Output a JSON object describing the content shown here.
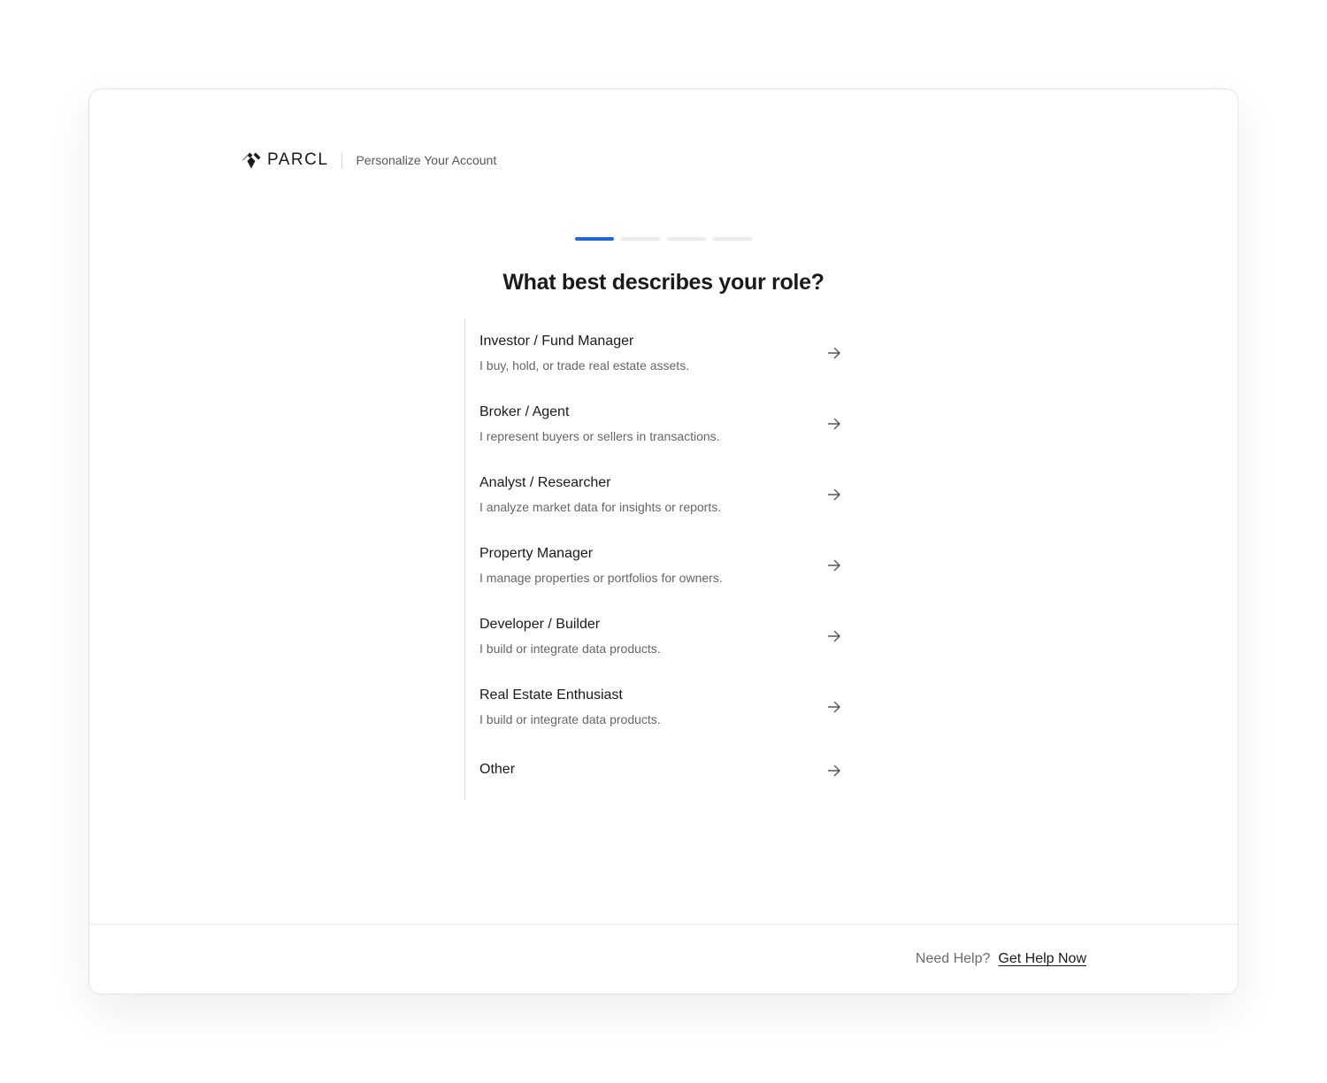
{
  "brand": {
    "logo_text": "PARCL",
    "subtitle": "Personalize Your Account"
  },
  "stepper": {
    "total_steps": 4,
    "current_step": 1,
    "accent_color": "#2563d9"
  },
  "question": "What best describes your role?",
  "options": [
    {
      "title": "Investor / Fund Manager",
      "description": "I buy, hold, or trade real estate assets."
    },
    {
      "title": "Broker / Agent",
      "description": "I represent buyers or sellers in transactions."
    },
    {
      "title": "Analyst / Researcher",
      "description": "I analyze market data for insights or reports."
    },
    {
      "title": "Property Manager",
      "description": "I manage properties or portfolios for owners."
    },
    {
      "title": "Developer / Builder",
      "description": "I build or integrate data products."
    },
    {
      "title": "Real Estate Enthusiast",
      "description": "I build or integrate data products."
    },
    {
      "title": "Other",
      "description": ""
    }
  ],
  "option_icon": "arrow-right-icon",
  "footer": {
    "help_label": "Need Help?",
    "help_link": "Get Help Now"
  }
}
